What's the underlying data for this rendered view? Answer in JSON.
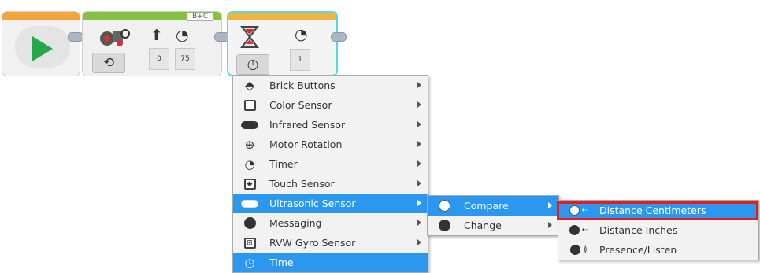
{
  "blocks": {
    "start": {
      "icon": "play-icon"
    },
    "motor": {
      "port_label": "B+C",
      "mode_icon": "rotate-icon",
      "param_1": "0",
      "param_2": "75"
    },
    "wait": {
      "mode_icon": "clock-icon",
      "param_1": "1"
    }
  },
  "menu": {
    "items": [
      {
        "label": "Brick Buttons",
        "icon": "brick-buttons-icon",
        "has_submenu": true
      },
      {
        "label": "Color Sensor",
        "icon": "color-sensor-icon",
        "has_submenu": true
      },
      {
        "label": "Infrared Sensor",
        "icon": "infrared-sensor-icon",
        "has_submenu": true
      },
      {
        "label": "Motor Rotation",
        "icon": "motor-rotation-icon",
        "has_submenu": true
      },
      {
        "label": "Timer",
        "icon": "timer-icon",
        "has_submenu": true
      },
      {
        "label": "Touch Sensor",
        "icon": "touch-sensor-icon",
        "has_submenu": true
      },
      {
        "label": "Ultrasonic Sensor",
        "icon": "ultrasonic-sensor-icon",
        "has_submenu": true,
        "highlighted": true
      },
      {
        "label": "Messaging",
        "icon": "messaging-icon",
        "has_submenu": true
      },
      {
        "label": "RVW Gyro Sensor",
        "icon": "gyro-sensor-icon",
        "has_submenu": true
      },
      {
        "label": "Time",
        "icon": "time-icon",
        "has_submenu": false,
        "highlighted": true
      }
    ]
  },
  "submenu": {
    "items": [
      {
        "label": "Compare",
        "icon": "compare-icon",
        "has_submenu": true,
        "highlighted": true
      },
      {
        "label": "Change",
        "icon": "change-icon",
        "has_submenu": true
      }
    ]
  },
  "submenu2": {
    "items": [
      {
        "label": "Distance Centimeters",
        "icon": "distance-cm-icon",
        "highlighted": true,
        "outlined": true
      },
      {
        "label": "Distance Inches",
        "icon": "distance-inches-icon"
      },
      {
        "label": "Presence/Listen",
        "icon": "presence-listen-icon"
      }
    ]
  },
  "colors": {
    "highlight": "#2b97ee",
    "outline": "#e02020",
    "selected_block_border": "#58d9e6"
  }
}
